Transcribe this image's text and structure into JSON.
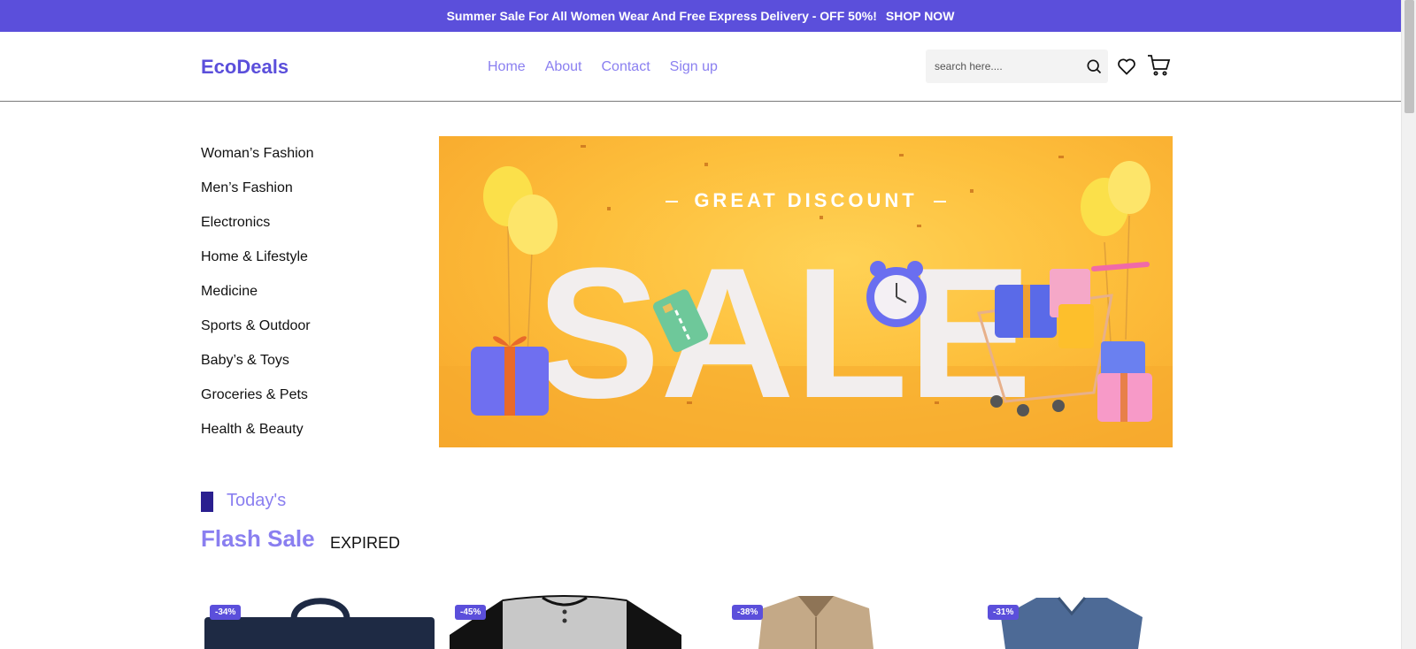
{
  "topbar": {
    "message": "Summer Sale For All Women Wear And Free Express Delivery - OFF 50%!",
    "cta": "SHOP NOW"
  },
  "header": {
    "logo": "EcoDeals",
    "nav": [
      "Home",
      "About",
      "Contact",
      "Sign up"
    ],
    "search": {
      "placeholder": "search here....",
      "value": ""
    }
  },
  "sidebar": {
    "categories": [
      "Woman’s Fashion",
      "Men’s Fashion",
      "Electronics",
      "Home & Lifestyle",
      "Medicine",
      "Sports & Outdoor",
      "Baby’s & Toys",
      "Groceries & Pets",
      "Health & Beauty"
    ]
  },
  "hero": {
    "subtitle": "GREAT DISCOUNT",
    "headline": "SALE"
  },
  "section": {
    "label": "Today's",
    "title": "Flash Sale",
    "timer": "EXPIRED"
  },
  "products": [
    {
      "discount": "-34%",
      "image": "navy-tote-bag"
    },
    {
      "discount": "-45%",
      "image": "raglan-henley-shirt"
    },
    {
      "discount": "-38%",
      "image": "khaki-jacket"
    },
    {
      "discount": "-31%",
      "image": "blue-vneck-tshirt"
    }
  ],
  "colors": {
    "brand": "#5b4fdb",
    "accent_light": "#8a7ff0",
    "marker": "#2a1f8f",
    "hero_bg": "#fdbf3c"
  }
}
